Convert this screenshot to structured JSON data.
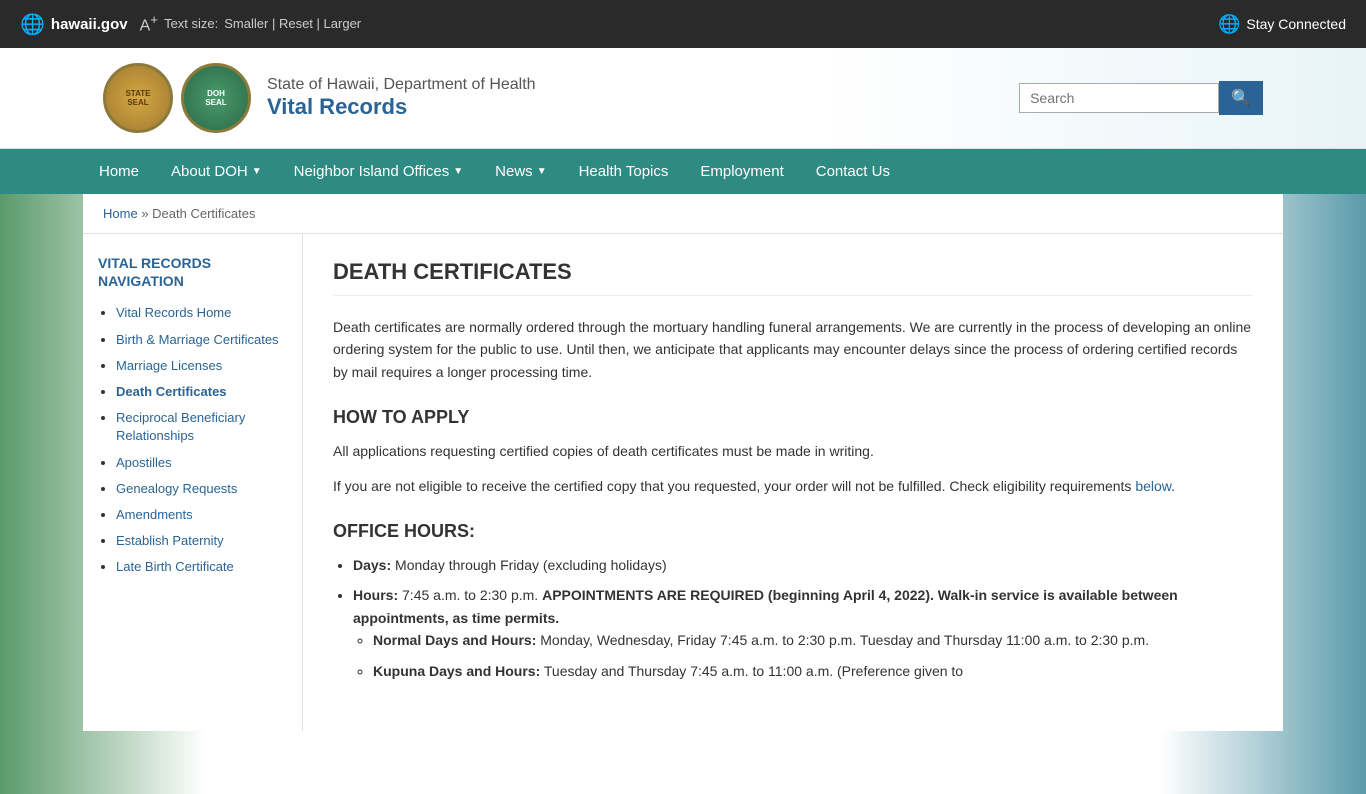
{
  "topbar": {
    "logo_text": "hawaii.gov",
    "text_size_label": "Text size:",
    "smaller": "Smaller",
    "reset": "Reset",
    "larger": "Larger",
    "stay_connected": "Stay Connected"
  },
  "header": {
    "dept_name": "State of Hawaii, Department of Health",
    "site_name": "Vital Records",
    "search_placeholder": "Search",
    "search_button_label": "🔍"
  },
  "nav": {
    "items": [
      {
        "label": "Home",
        "has_dropdown": false
      },
      {
        "label": "About DOH",
        "has_dropdown": true
      },
      {
        "label": "Neighbor Island Offices",
        "has_dropdown": true
      },
      {
        "label": "News",
        "has_dropdown": true
      },
      {
        "label": "Health Topics",
        "has_dropdown": false
      },
      {
        "label": "Employment",
        "has_dropdown": false
      },
      {
        "label": "Contact Us",
        "has_dropdown": false
      }
    ]
  },
  "breadcrumb": {
    "home": "Home",
    "separator": "»",
    "current": "Death Certificates"
  },
  "sidebar": {
    "title": "VITAL RECORDS NAVIGATION",
    "items": [
      {
        "label": "Vital Records Home",
        "active": false
      },
      {
        "label": "Birth & Marriage Certificates",
        "active": false
      },
      {
        "label": "Marriage Licenses",
        "active": false
      },
      {
        "label": "Death Certificates",
        "active": true
      },
      {
        "label": "Reciprocal Beneficiary Relationships",
        "active": false
      },
      {
        "label": "Apostilles",
        "active": false
      },
      {
        "label": "Genealogy Requests",
        "active": false
      },
      {
        "label": "Amendments",
        "active": false
      },
      {
        "label": "Establish Paternity",
        "active": false
      },
      {
        "label": "Late Birth Certificate",
        "active": false
      }
    ]
  },
  "main": {
    "page_title": "DEATH CERTIFICATES",
    "intro_paragraph": "Death certificates are normally ordered through the mortuary handling funeral arrangements. We are currently in the process of developing an online ordering system for the public to use. Until then, we anticipate that applicants may encounter delays since the process of ordering certified records by mail requires a longer processing time.",
    "how_to_apply_heading": "HOW TO APPLY",
    "how_to_apply_p1": "All applications requesting certified copies of death certificates must be made in writing.",
    "how_to_apply_p2": "If you are not eligible to receive the certified copy that you requested, your order will not be fulfilled. Check eligibility requirements ",
    "how_to_apply_link": "below",
    "how_to_apply_p2_end": ".",
    "office_hours_heading": "OFFICE HOURS:",
    "days_label": "Days:",
    "days_value": "Monday through Friday (excluding holidays)",
    "hours_label": "Hours:",
    "hours_value": "7:45 a.m. to 2:30 p.m.  APPOINTMENTS ARE REQUIRED (beginning April 4, 2022).  Walk-in service is available between appointments, as time permits.",
    "normal_hours_label": "Normal Days and Hours:",
    "normal_hours_value": " Monday, Wednesday, Friday 7:45 a.m. to 2:30 p.m.  Tuesday and Thursday 11:00 a.m. to 2:30 p.m.",
    "kupuna_hours_label": "Kupuna Days and Hours:",
    "kupuna_hours_value": " Tuesday and Thursday 7:45 a.m. to 11:00 a.m. (Preference given to"
  }
}
